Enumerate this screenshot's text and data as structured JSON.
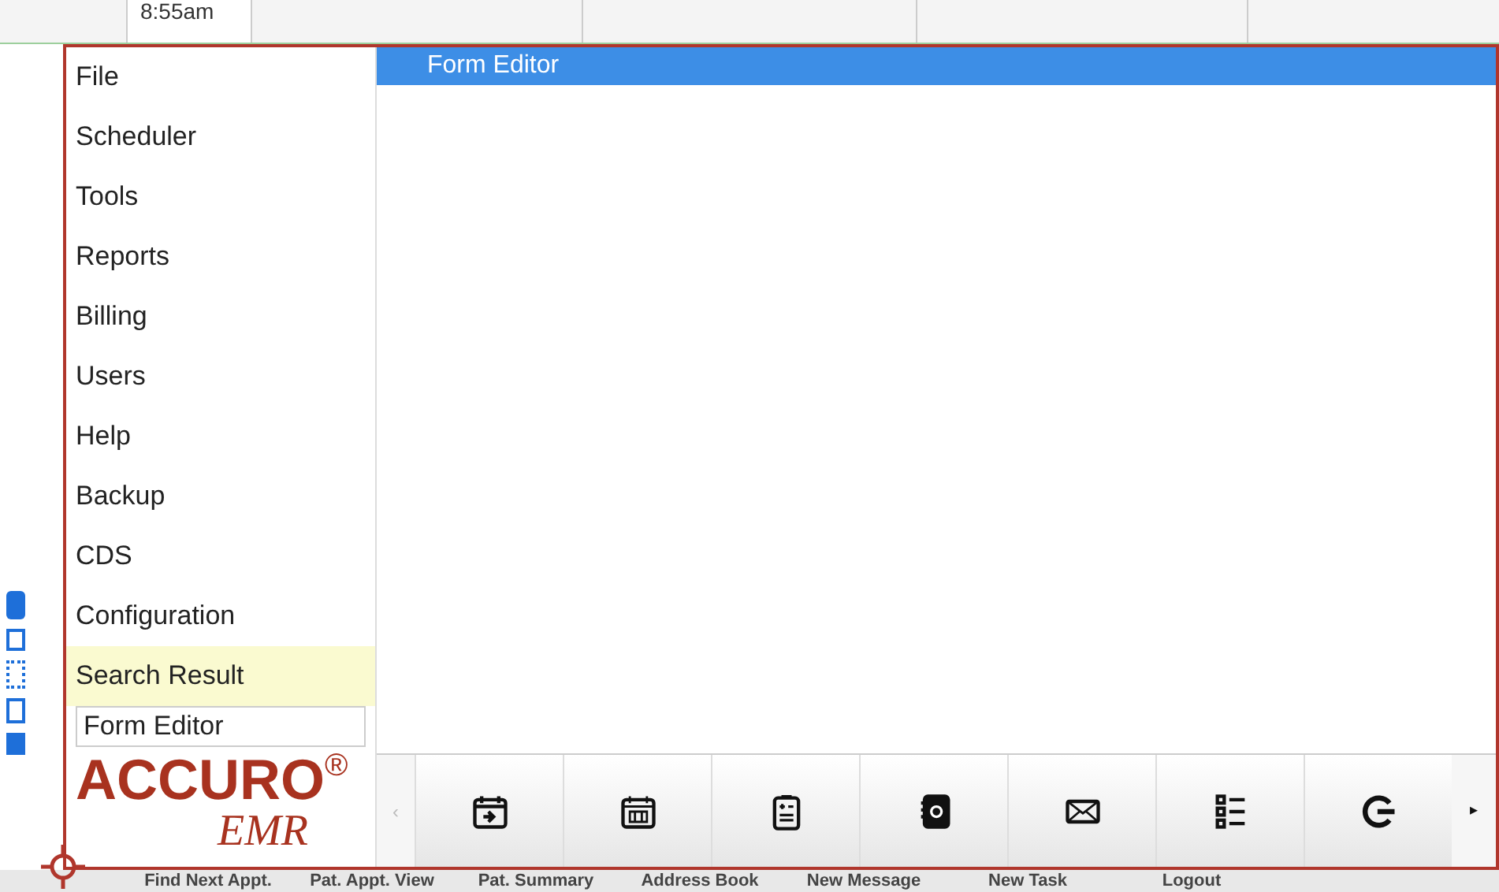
{
  "background_schedule": {
    "time": "8:55am"
  },
  "menu": {
    "items": [
      {
        "label": "File",
        "selected": false
      },
      {
        "label": "Scheduler",
        "selected": false
      },
      {
        "label": "Tools",
        "selected": false
      },
      {
        "label": "Reports",
        "selected": false
      },
      {
        "label": "Billing",
        "selected": false
      },
      {
        "label": "Users",
        "selected": false
      },
      {
        "label": "Help",
        "selected": false
      },
      {
        "label": "Backup",
        "selected": false
      },
      {
        "label": "CDS",
        "selected": false
      },
      {
        "label": "Configuration",
        "selected": false
      },
      {
        "label": "Search Result",
        "selected": true
      }
    ],
    "search": {
      "value": "Form Editor"
    },
    "logo": {
      "brand": "ACCURO",
      "mark": "®",
      "sub": "EMR"
    }
  },
  "results": [
    {
      "label": "Form Editor",
      "selected": true
    }
  ],
  "toolbar": {
    "prev_arrow": "‹",
    "next_arrow": "▸",
    "buttons": [
      {
        "label": "Find Next Appt."
      },
      {
        "label": "Pat. Appt. View"
      },
      {
        "label": "Pat. Summary"
      },
      {
        "label": "Address Book"
      },
      {
        "label": "New Message"
      },
      {
        "label": "New Task"
      },
      {
        "label": "Logout"
      }
    ]
  }
}
